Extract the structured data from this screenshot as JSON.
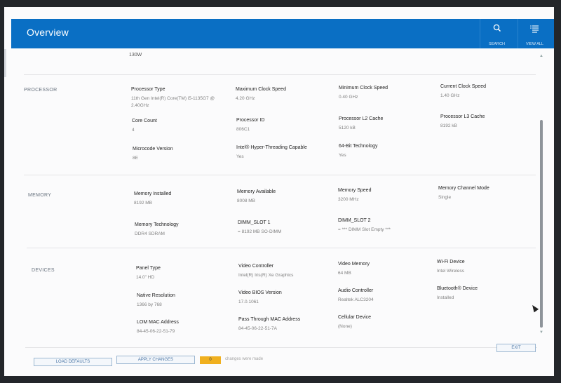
{
  "header": {
    "title": "Overview",
    "search_label": "SEARCH",
    "view_all_label": "VIEW ALL"
  },
  "power": {
    "value": "130W"
  },
  "sections": {
    "processor": {
      "label": "PROCESSOR",
      "items": [
        {
          "title": "Processor Type",
          "value": "11th Gen Intel(R) Core(TM) i5-1135G7 @ 2.40GHz"
        },
        {
          "title": "Maximum Clock Speed",
          "value": "4.20 GHz"
        },
        {
          "title": "Minimum Clock Speed",
          "value": "0.40 GHz"
        },
        {
          "title": "Current Clock Speed",
          "value": "1.40 GHz"
        },
        {
          "title": "Core Count",
          "value": "4"
        },
        {
          "title": "Processor ID",
          "value": "806C1"
        },
        {
          "title": "Processor L2 Cache",
          "value": "5120 kB"
        },
        {
          "title": "Processor L3 Cache",
          "value": "8192 kB"
        },
        {
          "title": "Microcode Version",
          "value": "8E"
        },
        {
          "title": "Intel® Hyper-Threading Capable",
          "value": "Yes"
        },
        {
          "title": "64-Bit Technology",
          "value": "Yes"
        }
      ]
    },
    "memory": {
      "label": "MEMORY",
      "items": [
        {
          "title": "Memory Installed",
          "value": "8192 MB"
        },
        {
          "title": "Memory Available",
          "value": "8008 MB"
        },
        {
          "title": "Memory Speed",
          "value": "3200 MHz"
        },
        {
          "title": "Memory Channel Mode",
          "value": "Single"
        },
        {
          "title": "Memory Technology",
          "value": "DDR4 SDRAM"
        },
        {
          "title": "DIMM_SLOT 1",
          "value": "= 8192 MB SO-DIMM"
        },
        {
          "title": "DIMM_SLOT 2",
          "value": "= *** DIMM Slot Empty ***"
        }
      ]
    },
    "devices": {
      "label": "DEVICES",
      "items": [
        {
          "title": "Panel Type",
          "value": "14.0\" HD"
        },
        {
          "title": "Video Controller",
          "value": "Intel(R) Iris(R) Xe Graphics"
        },
        {
          "title": "Video Memory",
          "value": "64 MB"
        },
        {
          "title": "Wi-Fi Device",
          "value": "Intel Wireless"
        },
        {
          "title": "Native Resolution",
          "value": "1366 by 768"
        },
        {
          "title": "Video BIOS Version",
          "value": "17.0.1061"
        },
        {
          "title": "Audio Controller",
          "value": "Realtek ALC3204"
        },
        {
          "title": "Bluetooth® Device",
          "value": "Installed"
        },
        {
          "title": "LOM MAC Address",
          "value": "84-45-06-22-51-79"
        },
        {
          "title": "Pass Through MAC Address",
          "value": "84-45-06-22-51-7A"
        },
        {
          "title": "Cellular Device",
          "value": "(None)"
        }
      ]
    }
  },
  "footer": {
    "load_defaults": "LOAD DEFAULTS",
    "apply_changes": "APPLY CHANGES",
    "changes_count": "0",
    "changes_text": "changes were made",
    "exit": "EXIT"
  },
  "colors": {
    "accent": "#0a6fc4",
    "badge": "#f0b01f"
  }
}
